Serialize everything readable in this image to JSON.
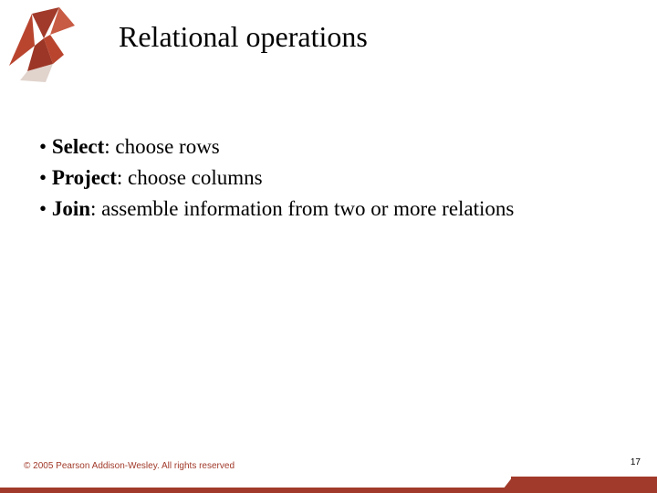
{
  "slide": {
    "title": "Relational operations",
    "bullets": [
      {
        "term": "Select",
        "rest": ": choose rows"
      },
      {
        "term": "Project",
        "rest": ": choose columns"
      },
      {
        "term": "Join",
        "rest": ": assemble information from two or more relations"
      }
    ],
    "copyright": "© 2005 Pearson Addison-Wesley. All rights reserved",
    "page": "17"
  }
}
